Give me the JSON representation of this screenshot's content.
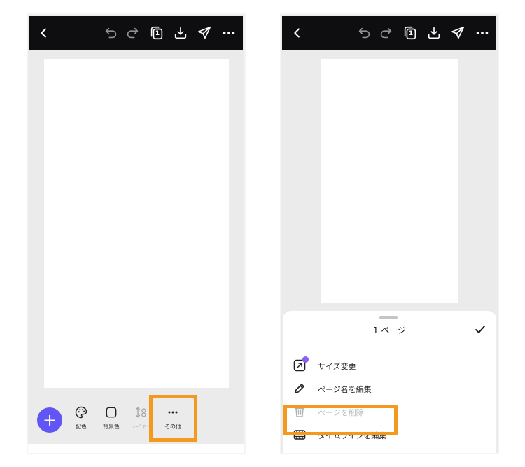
{
  "colors": {
    "accent": "#6155f5",
    "highlight": "#f39a1e",
    "topbar": "#0e0e10",
    "workspace": "#ebebeb",
    "pro_badge": "#8b5cf6"
  },
  "left_screen": {
    "topbar": {
      "icons": [
        "back-icon",
        "undo-icon",
        "redo-icon",
        "pages-icon",
        "download-icon",
        "share-send-icon",
        "more-icon"
      ],
      "page_count": "1"
    },
    "fab_label": "+",
    "toolbar": [
      {
        "icon": "palette-icon",
        "label": "配色",
        "enabled": true
      },
      {
        "icon": "background-color-icon",
        "label": "背景色",
        "enabled": true
      },
      {
        "icon": "layers-icon",
        "label": "レイヤー",
        "enabled": false
      },
      {
        "icon": "more-icon",
        "label": "その他",
        "enabled": true,
        "highlighted": true
      }
    ]
  },
  "right_screen": {
    "topbar": {
      "icons": [
        "back-icon",
        "undo-icon",
        "redo-icon",
        "pages-icon",
        "download-icon",
        "share-send-icon",
        "more-icon"
      ],
      "page_count": "1"
    },
    "sheet": {
      "title": "1 ページ",
      "confirm_icon": "check-icon",
      "items": [
        {
          "icon": "resize-icon",
          "label": "サイズ変更",
          "enabled": true,
          "pro": true
        },
        {
          "icon": "pencil-icon",
          "label": "ページ名を編集",
          "enabled": true
        },
        {
          "icon": "trash-icon",
          "label": "ページを削除",
          "enabled": false
        },
        {
          "icon": "film-timeline-icon",
          "label": "タイムラインを編集",
          "enabled": true,
          "highlighted": true
        }
      ]
    }
  }
}
